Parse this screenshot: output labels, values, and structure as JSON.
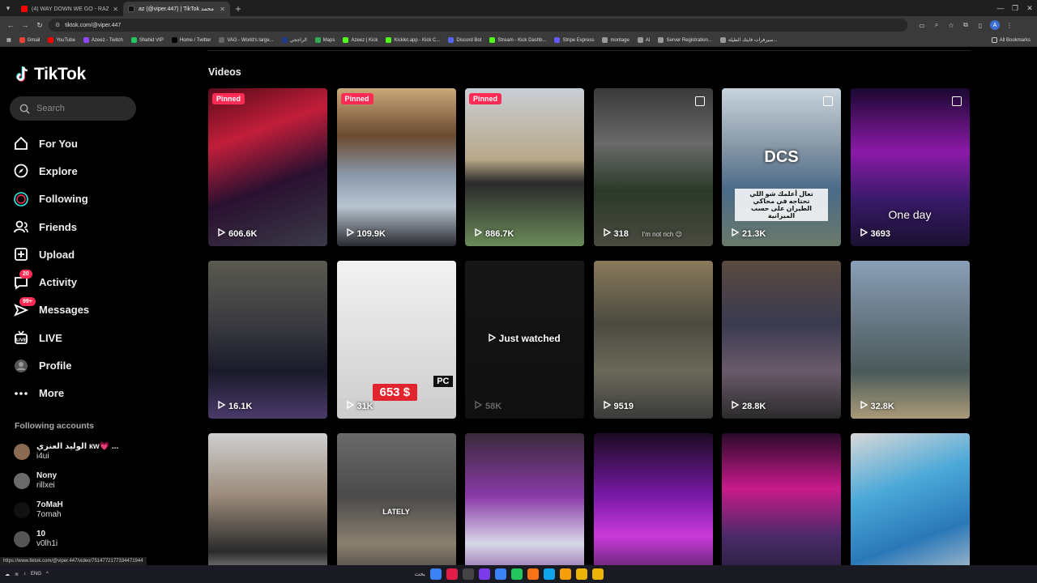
{
  "browser": {
    "tabs": [
      {
        "title": "(4) WAY DOWN WE GO - RAZE",
        "favicon_color": "#ff0000",
        "active": false
      },
      {
        "title": "az (@viper.447) | TikTok محمد",
        "favicon_color": "#111111",
        "active": true
      }
    ],
    "url": "tiktok.com/@viper.447",
    "bookmarks": [
      {
        "label": "Gmail",
        "color": "#ea4335"
      },
      {
        "label": "YouTube",
        "color": "#ff0000"
      },
      {
        "label": "Azeez - Twitch",
        "color": "#9146ff"
      },
      {
        "label": "Shahid VIP",
        "color": "#22c55e"
      },
      {
        "label": "Home / Twitter",
        "color": "#000000"
      },
      {
        "label": "VAG - World's large...",
        "color": "#666666"
      },
      {
        "label": "الراجحي",
        "color": "#1e3a8a"
      },
      {
        "label": "Maps",
        "color": "#34a853"
      },
      {
        "label": "Azeez | Kick",
        "color": "#53fc18"
      },
      {
        "label": "Kicklet.app - Kick C...",
        "color": "#53fc18"
      },
      {
        "label": "Discord Bot",
        "color": "#5865f2"
      },
      {
        "label": "Stream - Kick Dashb...",
        "color": "#53fc18"
      },
      {
        "label": "Stripe Express",
        "color": "#635bff"
      },
      {
        "label": "montage",
        "color": "#999999"
      },
      {
        "label": "AI",
        "color": "#999999"
      },
      {
        "label": "Server Registration...",
        "color": "#999999"
      },
      {
        "label": "سيرفرات فاينك الطيلة...",
        "color": "#999999"
      }
    ],
    "all_bookmarks": "All Bookmarks",
    "profile_initial": "A"
  },
  "sidebar": {
    "logo_text": "TikTok",
    "search_placeholder": "Search",
    "nav": [
      {
        "label": "For You",
        "icon": "home-icon"
      },
      {
        "label": "Explore",
        "icon": "compass-icon"
      },
      {
        "label": "Following",
        "icon": "following-icon"
      },
      {
        "label": "Friends",
        "icon": "friends-icon"
      },
      {
        "label": "Upload",
        "icon": "upload-icon"
      },
      {
        "label": "Activity",
        "icon": "activity-icon",
        "badge": "20"
      },
      {
        "label": "Messages",
        "icon": "messages-icon",
        "badge": "99+"
      },
      {
        "label": "LIVE",
        "icon": "live-icon"
      },
      {
        "label": "Profile",
        "icon": "profile-icon"
      },
      {
        "label": "More",
        "icon": "more-icon"
      }
    ],
    "following_heading": "Following accounts",
    "accounts": [
      {
        "name": "الوليد العنزي кw💗 ...",
        "handle": "i4ui",
        "color": "#8a6a50"
      },
      {
        "name": "Nony",
        "handle": "rillxei",
        "color": "#6a6a6a"
      },
      {
        "name": "7oMaH",
        "handle": "7omah",
        "color": "#111111"
      },
      {
        "name": "10",
        "handle": "v0lh1i",
        "color": "#555555"
      }
    ]
  },
  "main": {
    "section_title": "Videos",
    "videos": [
      {
        "views": "606.6K",
        "pinned": "Pinned",
        "bg": "linear-gradient(160deg,#5a0b1a 0%,#c21e3a 30%,#2a1030 60%,#3a3a48 100%)"
      },
      {
        "views": "109.9K",
        "pinned": "Pinned",
        "bg": "linear-gradient(180deg,#c9a87a 0%,#6b4a30 30%,#8a98aa 55%,#b8c4d0 75%,#2a2a30 100%)"
      },
      {
        "views": "886.7K",
        "pinned": "Pinned",
        "bg": "linear-gradient(180deg,#c9ced6 0%,#b8a888 45%,#2a2a2a 60%,#6a8a58 100%)"
      },
      {
        "views": "318",
        "bg": "linear-gradient(180deg,#3a3a3a 0%,#6a6a6a 35%,#2a3a28 65%,#4a4a40 100%)",
        "caption": "I'm not rich 😉",
        "multi": true
      },
      {
        "views": "21.3K",
        "bg": "linear-gradient(180deg,#c8d4de 0%,#8a9aa8 35%,#4a6a88 65%,#6a7a6a 100%)",
        "headline": "DCS",
        "subcaption": "تعال أعلمك شو اللي تحتاجه في محاكي الطيران على حسب الميزانية",
        "multi": true
      },
      {
        "views": "3693",
        "bg": "linear-gradient(180deg,#1a0830 0%,#8a1aa8 40%,#3a1a6a 70%,#1a1030 100%)",
        "caption": "One day",
        "multi": true
      },
      {
        "views": "16.1K",
        "bg": "linear-gradient(180deg,#5a5a50 0%,#3a3a40 40%,#1a1a2a 70%,#4a3a6a 100%)"
      },
      {
        "views": "31K",
        "bg": "linear-gradient(180deg,#f2f2f2 0%,#e0e0e0 50%,#cccccc 100%)",
        "price": "653 $",
        "tag": "PC"
      },
      {
        "views": "58K",
        "bg": "linear-gradient(180deg,#3a3a3a 0%,#2a2a2a 100%)",
        "dimmed": true,
        "center_label": "Just watched"
      },
      {
        "views": "9519",
        "bg": "linear-gradient(180deg,#8a7a5a 0%,#4a4a40 40%,#6a6a5a 70%,#3a3a3a 100%)"
      },
      {
        "views": "28.8K",
        "bg": "linear-gradient(180deg,#5a4a40 0%,#3a3a50 40%,#6a5a6a 70%,#2a2a2a 100%)"
      },
      {
        "views": "32.8K",
        "bg": "linear-gradient(180deg,#8aa0b8 0%,#6a7a88 35%,#4a5a5a 70%,#aa9a78 100%)"
      },
      {
        "views": "",
        "bg": "linear-gradient(180deg,#cfcfcf 0%,#9a8a7a 40%,#2a2a2a 75%,#d8d8d8 100%)"
      },
      {
        "views": "",
        "bg": "linear-gradient(180deg,#6a6a6a 0%,#4a4a4a 40%,#8a8070 70%,#2a2a2a 100%)",
        "caption": "LATELY"
      },
      {
        "views": "",
        "bg": "linear-gradient(180deg,#3a2a3a 0%,#8a3aa8 40%,#d8d8e8 70%,#6a2a8a 100%)"
      },
      {
        "views": "",
        "bg": "linear-gradient(180deg,#1a0a20 0%,#7a1aa8 40%,#c83ad8 65%,#2a1a3a 100%)"
      },
      {
        "views": "",
        "bg": "linear-gradient(180deg,#2a0a2a 0%,#c81a8a 35%,#4a2a6a 65%,#1a1a2a 100%)"
      },
      {
        "views": "",
        "bg": "linear-gradient(160deg,#d8d8d8 0%,#4aa8d8 35%,#2a78b8 65%,#d0d0d0 100%)"
      }
    ]
  },
  "status_url": "https://www.tiktok.com/@viper.447/video/7514772177334471944",
  "taskbar": {
    "lang": "ENG",
    "search_label": "بحث",
    "apps": [
      "#e11d48",
      "#444444",
      "#7c3aed",
      "#3b82f6",
      "#22c55e",
      "#f97316",
      "#0ea5e9",
      "#f59e0b",
      "#eab308",
      "#eab308"
    ]
  }
}
